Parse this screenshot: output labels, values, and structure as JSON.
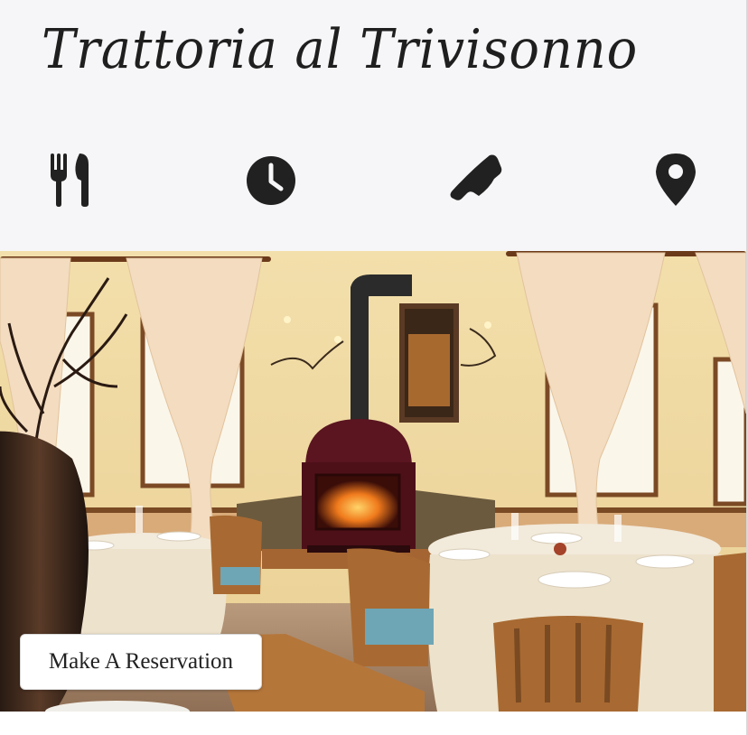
{
  "header": {
    "title": "Trattoria al Trivisonno"
  },
  "nav_icons": [
    {
      "name": "utensils-icon",
      "meaning": "menu"
    },
    {
      "name": "clock-icon",
      "meaning": "hours"
    },
    {
      "name": "phone-icon",
      "meaning": "call"
    },
    {
      "name": "map-marker-icon",
      "meaning": "location"
    }
  ],
  "hero": {
    "reserve_label": "Make A Reservation"
  },
  "colors": {
    "header_bg": "#f6f6f8",
    "icon_color": "#212121",
    "wall": "#f2dca4",
    "curtain": "#f3dcc0",
    "tablecloth": "#ede2cc",
    "stove": "#5a1520",
    "wood": "#a86a32"
  }
}
